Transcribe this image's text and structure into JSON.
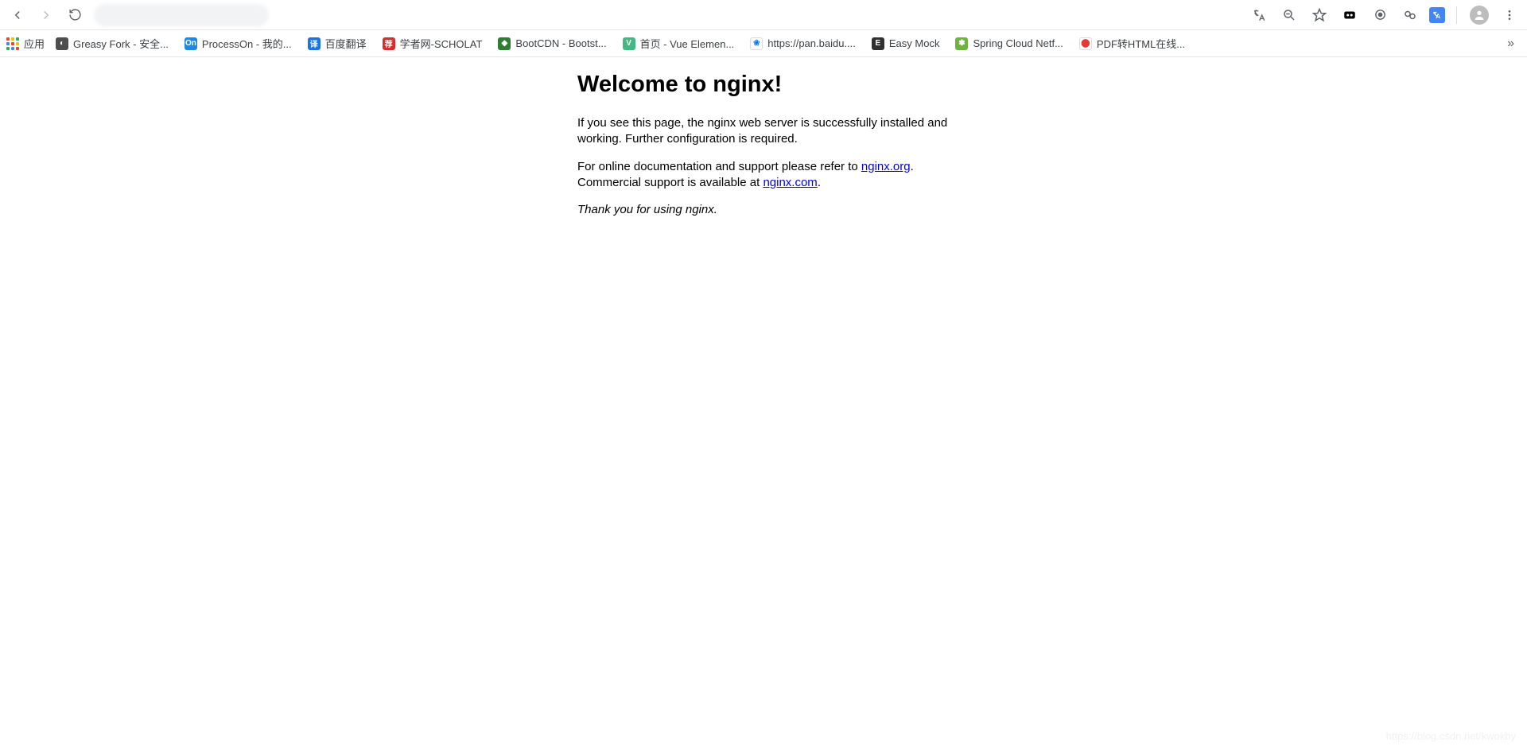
{
  "toolbar": {
    "omnibox_value": "  "
  },
  "bookmarks": {
    "apps_label": "应用",
    "items": [
      {
        "label": "Greasy Fork - 安全...",
        "bg": "#4d4d4d",
        "glyph": "◐"
      },
      {
        "label": "ProcessOn - 我的...",
        "bg": "#1e88e5",
        "glyph": "On"
      },
      {
        "label": "百度翻译",
        "bg": "#1a73e8",
        "glyph": "译"
      },
      {
        "label": "学者网-SCHOLAT",
        "bg": "#d32f2f",
        "glyph": "荐"
      },
      {
        "label": "BootCDN - Bootst...",
        "bg": "#2e7d32",
        "glyph": "◆"
      },
      {
        "label": "首页 - Vue Elemen...",
        "bg": "#42b883",
        "glyph": "V"
      },
      {
        "label": "https://pan.baidu....",
        "bg": "#ffffff",
        "glyph": "❀",
        "fg": "#1a73e8",
        "border": "#dadce0"
      },
      {
        "label": "Easy Mock",
        "bg": "#303030",
        "glyph": "E"
      },
      {
        "label": "Spring Cloud Netf...",
        "bg": "#6db33f",
        "glyph": "❃"
      },
      {
        "label": "PDF转HTML在线...",
        "bg": "#ffffff",
        "glyph": "⬤",
        "fg": "#e53935",
        "border": "#dadce0"
      }
    ],
    "overflow_glyph": "»"
  },
  "page": {
    "title": "Welcome to nginx!",
    "p1_a": "If you see this page, the nginx web server is successfully installed and working. Further configuration is required.",
    "p2_a": "For online documentation and support please refer to ",
    "link_org": "nginx.org",
    "p2_b": ".",
    "p2_c": "Commercial support is available at ",
    "link_com": "nginx.com",
    "p2_d": ".",
    "p3": "Thank you for using nginx."
  },
  "watermark": "https://blog.csdn.net/kwokby"
}
